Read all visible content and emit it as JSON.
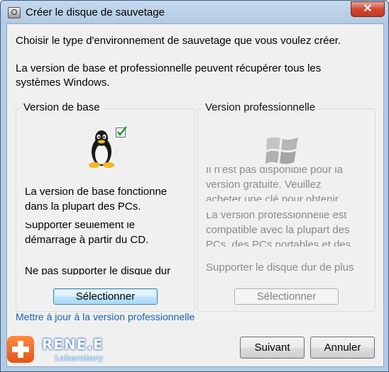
{
  "window": {
    "title": "Créer le disque de sauvetage",
    "close_glyph": "✕"
  },
  "intro": {
    "line1": "Choisir le type d'environnement de sauvetage que vous voulez créer.",
    "line2a": "La version de base et professionnelle peuvent récupérer tous les",
    "line2b": "systèmes Windows."
  },
  "basic": {
    "label": "Version de base",
    "icon": "linux-tux-icon",
    "check_icon": "checkmark-icon",
    "desc1a": "La version de base fonctionne",
    "desc1b": "dans la plupart des PCs.",
    "desc2a": "Supporter seulement le",
    "desc2b": "démarrage à partir du CD.",
    "desc3a": "Ne pas supporter le disque dur",
    "button": "Sélectionner"
  },
  "pro": {
    "label": "Version professionnelle",
    "icon": "windows-logo-icon",
    "desc1a": "Il n'est pas disponible pour la",
    "desc1b": "version gratuite. Veuillez",
    "desc1c": "acheter une clé pour obtenir",
    "desc2a": "La version professionnelle est",
    "desc2b": "compatible avec la plupart des",
    "desc2c": "PCs, des PCs portables et des",
    "desc3a": "Supporter le disque dur de plus",
    "button": "Sélectionner"
  },
  "upgrade_link": "Mettre à jour à la version professionnelle",
  "logo": {
    "name": "RENE.E",
    "sub": "Laboratory"
  },
  "footer": {
    "next": "Suivant",
    "cancel": "Annuler"
  },
  "colors": {
    "link": "#1a62b8",
    "logo_orange": "#e4551b",
    "close_red": "#c23a20"
  }
}
